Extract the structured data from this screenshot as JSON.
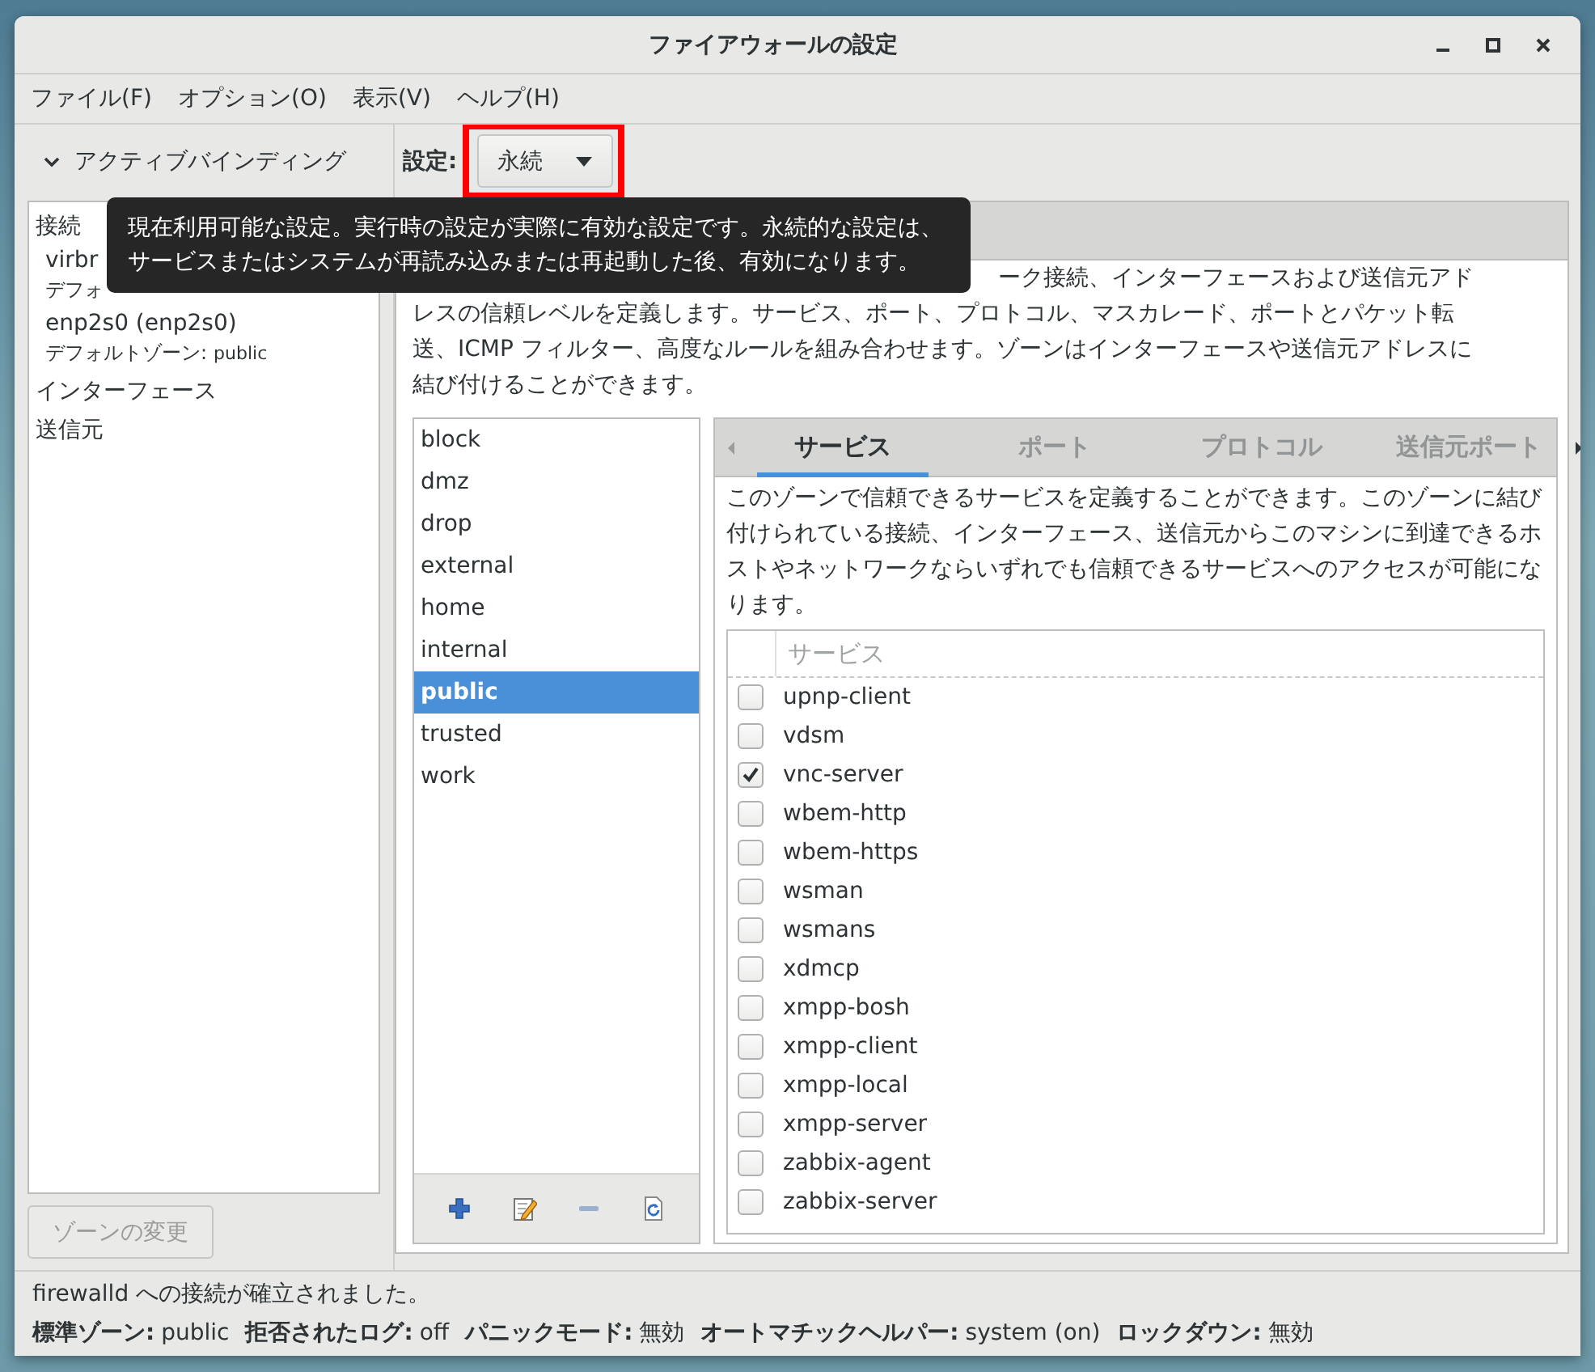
{
  "window": {
    "title": "ファイアウォールの設定"
  },
  "menu": [
    "ファイル(F)",
    "オプション(O)",
    "表示(V)",
    "ヘルプ(H)"
  ],
  "bindings": {
    "header": "アクティブバインディング",
    "expanded": true,
    "sections": [
      {
        "label": "接続",
        "children": [
          {
            "name": "virbr",
            "zone_label": "デフォ"
          },
          {
            "name": "enp2s0 (enp2s0)",
            "zone_label": "デフォルトゾーン:",
            "zone": "public"
          }
        ]
      },
      {
        "label": "インターフェース"
      },
      {
        "label": "送信元"
      }
    ]
  },
  "change_zone_button": {
    "label": "ゾーンの変更",
    "disabled": true
  },
  "config": {
    "label": "設定:",
    "value": "永続",
    "highlighted": true
  },
  "tooltip": "現在利用可能な設定。実行時の設定が実際に有効な設定です。永続的な設定は、サービスまたはシステムが再読み込みまたは再起動した後、有効になります。",
  "zone_description": [
    "ーク接続、インターフェースおよび送信元アド",
    "レスの信頼レベルを定義します。サービス、ポート、プロトコル、マスカレード、ポートとパケット転",
    "送、ICMP フィルター、高度なルールを組み合わせます。ゾーンはインターフェースや送信元アドレスに",
    "結び付けることができます。"
  ],
  "zones": [
    {
      "name": "block",
      "selected": false
    },
    {
      "name": "dmz",
      "selected": false
    },
    {
      "name": "drop",
      "selected": false
    },
    {
      "name": "external",
      "selected": false
    },
    {
      "name": "home",
      "selected": false
    },
    {
      "name": "internal",
      "selected": false
    },
    {
      "name": "public",
      "selected": true
    },
    {
      "name": "trusted",
      "selected": false
    },
    {
      "name": "work",
      "selected": false
    }
  ],
  "service_tabs": [
    {
      "label": "サービス",
      "selected": true
    },
    {
      "label": "ポート",
      "selected": false
    },
    {
      "label": "プロトコル",
      "selected": false
    },
    {
      "label": "送信元ポート",
      "selected": false
    }
  ],
  "services_description": "このゾーンで信頼できるサービスを定義することができます。このゾーンに結び付けられている接続、インターフェース、送信元からこのマシンに到達できるホストやネットワークならいずれでも信頼できるサービスへのアクセスが可能になります。",
  "services_table": {
    "column": "サービス",
    "rows": [
      {
        "name": "upnp-client",
        "checked": false
      },
      {
        "name": "vdsm",
        "checked": false
      },
      {
        "name": "vnc-server",
        "checked": true
      },
      {
        "name": "wbem-http",
        "checked": false
      },
      {
        "name": "wbem-https",
        "checked": false
      },
      {
        "name": "wsman",
        "checked": false
      },
      {
        "name": "wsmans",
        "checked": false
      },
      {
        "name": "xdmcp",
        "checked": false
      },
      {
        "name": "xmpp-bosh",
        "checked": false
      },
      {
        "name": "xmpp-client",
        "checked": false
      },
      {
        "name": "xmpp-local",
        "checked": false
      },
      {
        "name": "xmpp-server",
        "checked": false
      },
      {
        "name": "zabbix-agent",
        "checked": false
      },
      {
        "name": "zabbix-server",
        "checked": false
      }
    ]
  },
  "status_message": "firewalld への接続が確立されました。",
  "status_fields": [
    {
      "label": "標準ゾーン:",
      "value": "public"
    },
    {
      "label": "拒否されたログ:",
      "value": "off"
    },
    {
      "label": "パニックモード:",
      "value": "無効"
    },
    {
      "label": "オートマチックヘルパー:",
      "value": "system (on)"
    },
    {
      "label": "ロックダウン:",
      "value": "無効"
    }
  ]
}
